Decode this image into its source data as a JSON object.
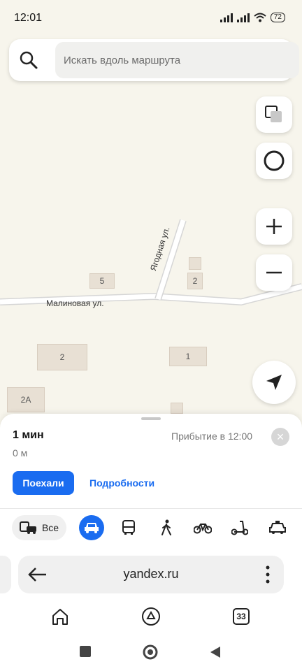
{
  "status_bar": {
    "time": "12:01",
    "battery": "72"
  },
  "search": {
    "placeholder": "Искать вдоль маршрута"
  },
  "map": {
    "street_labels": [
      "Малиновая ул.",
      "Ягодная ул."
    ],
    "building_numbers": [
      "5",
      "2",
      "2",
      "1",
      "2А"
    ]
  },
  "route_card": {
    "duration": "1 мин",
    "distance": "0 м",
    "arrival": "Прибытие в 12:00",
    "go_label": "Поехали",
    "details_label": "Подробности"
  },
  "transport_modes": {
    "all_label": "Все"
  },
  "browser": {
    "url": "yandex.ru",
    "tab_count": "33"
  },
  "colors": {
    "accent": "#1a6cf0"
  }
}
